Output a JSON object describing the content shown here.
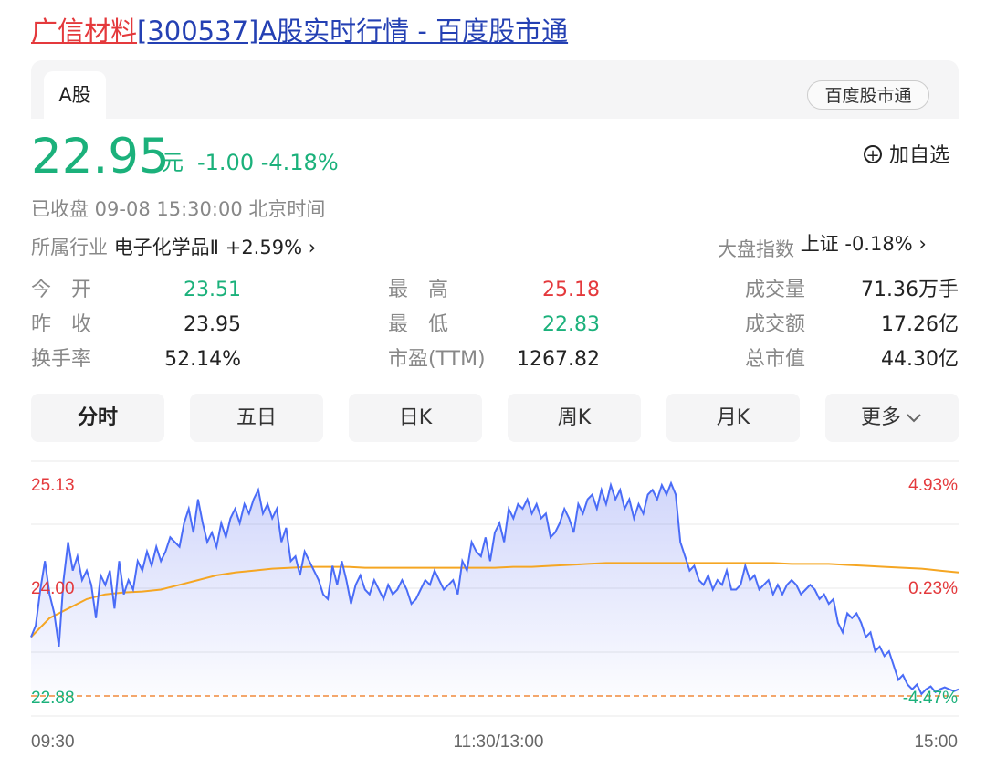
{
  "page_title": {
    "name": "广信材料",
    "rest": "[300537]A股实时行情 - 百度股市通"
  },
  "tabs": {
    "active": "A股",
    "badge": "百度股市通"
  },
  "quote": {
    "price": "22.95",
    "unit": "元",
    "change": "-1.00 -4.18%",
    "add_watchlist": "加自选",
    "status": "已收盘   09-08 15:30:00  北京时间",
    "industry_label": "所属行业",
    "industry_name": "电子化学品Ⅱ",
    "industry_change": "+2.59%",
    "market_label": "大盘指数",
    "market_value": "上证 -0.18%",
    "colors": {
      "up": "#e4393c",
      "down": "#1bb17b"
    }
  },
  "stats": [
    {
      "label": "今　开",
      "value": "23.51",
      "color": "#1bb17b"
    },
    {
      "label": "最　高",
      "value": "25.18",
      "color": "#e4393c"
    },
    {
      "label": "成交量",
      "value": "71.36万手",
      "color": "#222222"
    },
    {
      "label": "昨　收",
      "value": "23.95",
      "color": "#222222"
    },
    {
      "label": "最　低",
      "value": "22.83",
      "color": "#1bb17b"
    },
    {
      "label": "成交额",
      "value": "17.26亿",
      "color": "#222222"
    },
    {
      "label": "换手率",
      "value": "52.14%",
      "color": "#222222"
    },
    {
      "label": "市盈(TTM)",
      "value": "1267.82",
      "color": "#222222"
    },
    {
      "label": "总市值",
      "value": "44.30亿",
      "color": "#222222"
    }
  ],
  "periods": [
    "分时",
    "五日",
    "日K",
    "周K",
    "月K",
    "更多"
  ],
  "chart": {
    "y_left": [
      "25.13",
      "24.00",
      "22.88"
    ],
    "y_right": [
      "4.93%",
      "0.23%",
      "-4.47%"
    ],
    "x_labels": [
      "09:30",
      "11:30/13:00",
      "15:00"
    ]
  },
  "chart_data": {
    "type": "line",
    "title": "",
    "ylim": [
      22.88,
      25.13
    ],
    "prev_close": 23.95,
    "x": [
      0,
      240
    ],
    "series": [
      {
        "values": [
          23.5,
          23.62,
          24.0,
          24.3,
          23.95,
          23.75,
          23.4,
          24.1,
          24.5,
          24.2,
          24.35,
          24.1,
          24.2,
          24.05,
          23.7,
          24.15,
          24.05,
          24.2,
          23.8,
          24.3,
          23.95,
          24.1,
          24.0,
          24.3,
          24.2,
          24.4,
          24.25,
          24.45,
          24.3,
          24.4,
          24.55,
          24.5,
          24.45,
          24.7,
          24.85,
          24.6,
          24.95,
          24.7,
          24.5,
          24.6,
          24.45,
          24.7,
          24.55,
          24.75,
          24.85,
          24.7,
          24.9,
          24.8,
          24.95,
          25.05,
          24.8,
          24.9,
          24.75,
          24.85,
          24.5,
          24.65,
          24.3,
          24.35,
          24.15,
          24.4,
          24.3,
          24.2,
          24.1,
          23.95,
          23.9,
          24.25,
          24.05,
          24.3,
          24.1,
          23.85,
          24.05,
          24.15,
          24.0,
          23.95,
          24.1,
          24.0,
          23.9,
          24.05,
          23.95,
          24.0,
          24.1,
          24.0,
          23.85,
          23.9,
          24.0,
          24.1,
          24.05,
          24.2,
          24.1,
          24.0,
          24.05,
          24.1,
          23.95,
          24.3,
          24.2,
          24.5,
          24.4,
          24.35,
          24.55,
          24.3,
          24.6,
          24.7,
          24.5,
          24.85,
          24.75,
          24.9,
          24.85,
          24.95,
          24.8,
          24.9,
          24.75,
          24.8,
          24.55,
          24.6,
          24.7,
          24.85,
          24.75,
          24.6,
          24.9,
          24.8,
          24.95,
          25.0,
          24.85,
          25.05,
          24.9,
          25.1,
          24.95,
          25.05,
          24.85,
          24.95,
          24.75,
          24.9,
          24.8,
          25.0,
          25.05,
          24.95,
          25.1,
          25.0,
          25.12,
          25.0,
          24.5,
          24.35,
          24.2,
          24.25,
          24.1,
          24.05,
          24.15,
          24.0,
          24.1,
          24.05,
          24.2,
          24.0,
          24.0,
          24.05,
          24.25,
          24.1,
          24.15,
          24.0,
          24.05,
          24.1,
          23.95,
          24.05,
          23.95,
          24.05,
          24.1,
          24.05,
          23.95,
          24.0,
          24.05,
          24.0,
          23.9,
          23.95,
          23.85,
          23.9,
          23.65,
          23.55,
          23.75,
          23.7,
          23.75,
          23.65,
          23.5,
          23.55,
          23.35,
          23.4,
          23.3,
          23.35,
          23.2,
          23.05,
          23.1,
          23.0,
          22.95,
          23.0,
          22.9,
          22.95,
          22.98,
          22.92,
          22.95,
          22.97,
          22.95,
          22.93,
          22.95
        ]
      },
      {
        "values": [
          23.5,
          23.7,
          23.8,
          23.9,
          23.95,
          23.97,
          23.98,
          24.0,
          24.05,
          24.1,
          24.15,
          24.18,
          24.2,
          24.22,
          24.23,
          24.24,
          24.24,
          24.24,
          24.23,
          24.23,
          24.23,
          24.23,
          24.23,
          24.23,
          24.23,
          24.23,
          24.24,
          24.24,
          24.25,
          24.26,
          24.27,
          24.28,
          24.28,
          24.28,
          24.28,
          24.28,
          24.28,
          24.28,
          24.28,
          24.28,
          24.28,
          24.27,
          24.27,
          24.27,
          24.26,
          24.25,
          24.24,
          24.23,
          24.22,
          24.2,
          24.18
        ]
      }
    ]
  }
}
